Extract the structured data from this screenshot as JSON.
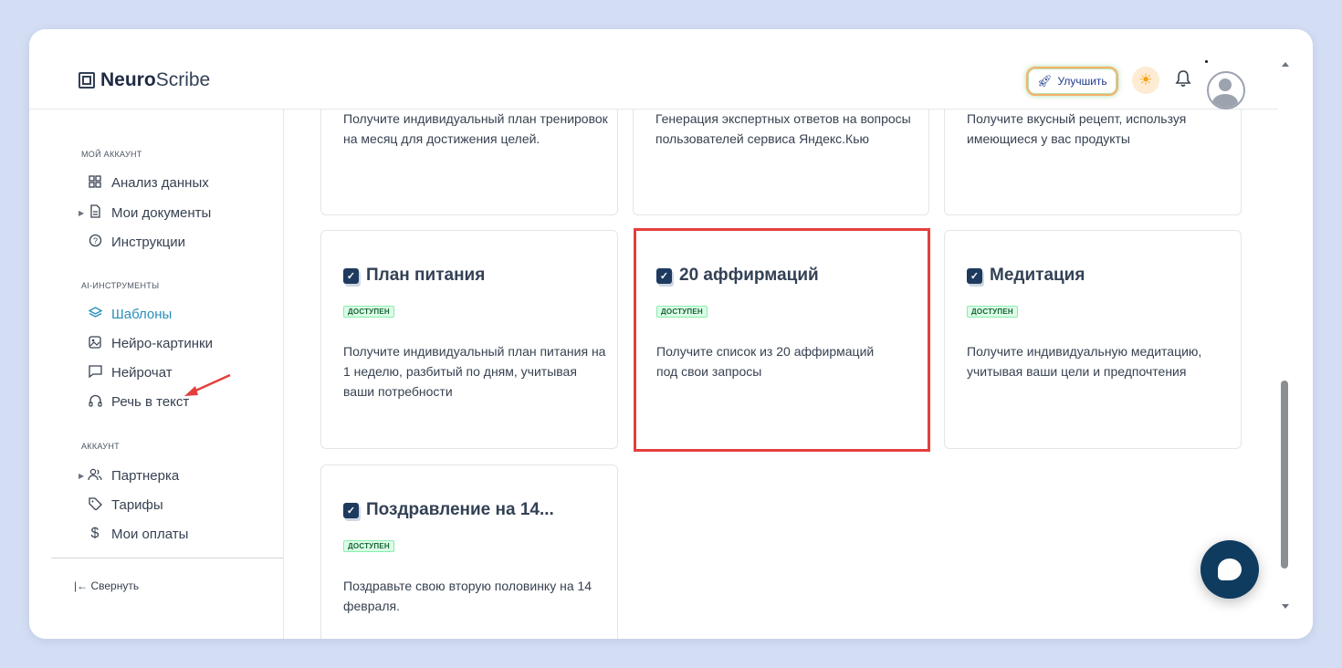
{
  "app": {
    "logo_bold": "Neuro",
    "logo_rest": "Scribe"
  },
  "header": {
    "upgrade_label": "Улучшить"
  },
  "sidebar": {
    "sections": [
      {
        "title": "МОЙ АККАУНТ",
        "items": [
          {
            "label": "Анализ данных",
            "icon": "grid-icon"
          },
          {
            "label": "Мои документы",
            "icon": "document-icon",
            "expandable": true
          },
          {
            "label": "Инструкции",
            "icon": "help-circle-icon"
          }
        ]
      },
      {
        "title": "AI-ИНСТРУМЕНТЫ",
        "items": [
          {
            "label": "Шаблоны",
            "icon": "layers-icon",
            "active": true
          },
          {
            "label": "Нейро-картинки",
            "icon": "image-icon"
          },
          {
            "label": "Нейрочат",
            "icon": "chat-icon"
          },
          {
            "label": "Речь в текст",
            "icon": "headphones-icon"
          }
        ]
      },
      {
        "title": "АККАУНТ",
        "items": [
          {
            "label": "Партнерка",
            "icon": "users-icon",
            "expandable": true
          },
          {
            "label": "Тарифы",
            "icon": "tag-icon"
          },
          {
            "label": "Мои оплаты",
            "icon": "dollar-icon"
          }
        ]
      }
    ],
    "collapse_label": "Свернуть"
  },
  "cards_top": [
    {
      "desc": "Получите индивидуальный план тренировок на месяц для достижения целей."
    },
    {
      "desc": "Генерация экспертных ответов на вопросы пользователей сервиса Яндекс.Кью"
    },
    {
      "desc": "Получите вкусный рецепт, используя имеющиеся у вас продукты"
    }
  ],
  "cards": [
    {
      "title": "План питания",
      "badge": "ДОСТУПЕН",
      "desc": "Получите индивидуальный план питания на 1 неделю, разбитый по дням, учитывая ваши потребности"
    },
    {
      "title": "20 аффирмаций",
      "badge": "ДОСТУПЕН",
      "desc": "Получите список из 20 аффирмаций под свои запросы",
      "highlighted": true
    },
    {
      "title": "Медитация",
      "badge": "ДОСТУПЕН",
      "desc": "Получите индивидуальную медитацию, учитывая ваши цели и предпочтения"
    },
    {
      "title": "Поздравление на 14...",
      "badge": "ДОСТУПЕН",
      "desc": "Поздравьте свою вторую половинку на 14 февраля."
    }
  ],
  "colors": {
    "accent": "#2a8fb8",
    "highlight": "#e53e3e",
    "badge_bg": "#dcfce7",
    "chat_button": "#0f3b5f"
  }
}
